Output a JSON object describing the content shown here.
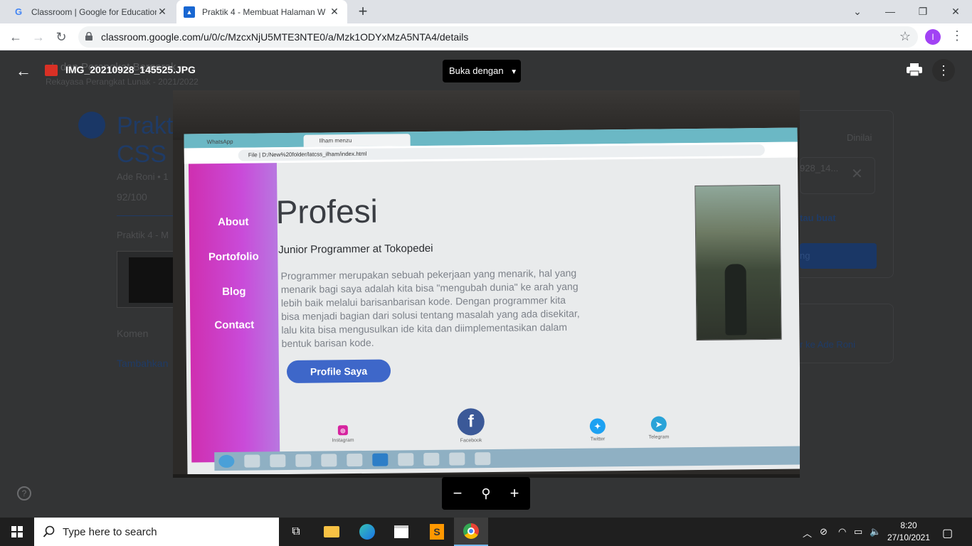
{
  "browser": {
    "tabs": [
      {
        "title": "Classroom | Google for Education"
      },
      {
        "title": "Praktik 4 - Membuat Halaman W"
      }
    ],
    "url": "classroom.google.com/u/0/c/MzcxNjU5MTE3NTE0/a/Mzk1ODYxMzA5NTA4/details",
    "profile_initial": "I"
  },
  "viewer": {
    "filename": "IMG_20210928_145525.JPG",
    "open_with": "Buka dengan"
  },
  "classroom_bg": {
    "header_title": "eb dan Perangkat Bergerak",
    "header_sub": "Rekayasa Perangkat Lunak - 2021/2022",
    "title": "Prakti CSS",
    "meta": "Ade Roni • 1",
    "score": "92/100",
    "desc": "Praktik 4 - M",
    "comments": "Komen",
    "add_comment": "Tambahkan",
    "graded": "Dinilai",
    "file_label": "928_14...",
    "create_label": "tau buat",
    "button_label": "ng",
    "private_comment": "r ke Ade Roni"
  },
  "photo_page": {
    "mini_tabs": [
      "WhatsApp",
      "Ilham menzu"
    ],
    "mini_url": "File | D:/New%20folder/latcss_ilham/index.html",
    "nav": [
      "About",
      "Portofolio",
      "Blog",
      "Contact"
    ],
    "title": "Profesi",
    "subtitle": "Junior Programmer at Tokopedei",
    "description": "Programmer merupakan sebuah pekerjaan yang menarik, hal yang menarik bagi saya adalah kita bisa \"mengubah dunia\" ke arah yang lebih baik melalui barisanbarisan kode. Dengan programmer kita bisa menjadi bagian dari solusi tentang masalah yang ada disekitar, lalu kita bisa mengusulkan ide kita dan diimplementasikan dalam bentuk barisan kode.",
    "button": "Profile Saya",
    "social": [
      {
        "label": "Instagram",
        "icon": "instagram-icon",
        "color": "#d6249f"
      },
      {
        "label": "Facebook",
        "icon": "facebook-icon",
        "color": "#3b5998"
      },
      {
        "label": "Twitter",
        "icon": "twitter-icon",
        "color": "#1da1f2"
      },
      {
        "label": "Telegram",
        "icon": "telegram-icon",
        "color": "#2aa3d8"
      }
    ]
  },
  "zoom": {
    "minus": "−",
    "plus": "+"
  },
  "taskbar": {
    "search_placeholder": "Type here to search",
    "time": "8:20",
    "date": "27/10/2021"
  },
  "colors": {
    "accent_purple": "#cf2fb0",
    "button_blue": "#3e67c9",
    "chrome_tab": "#dee1e6"
  }
}
